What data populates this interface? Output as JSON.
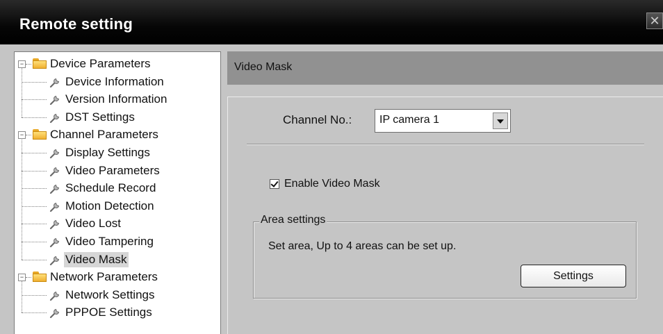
{
  "window": {
    "title": "Remote setting",
    "close_glyph": "✕"
  },
  "tree": {
    "groups": [
      {
        "label": "Device Parameters",
        "expanded": true,
        "children": [
          "Device Information",
          "Version Information",
          "DST Settings"
        ]
      },
      {
        "label": "Channel Parameters",
        "expanded": true,
        "children": [
          "Display Settings",
          "Video Parameters",
          "Schedule Record",
          "Motion Detection",
          "Video Lost",
          "Video Tampering",
          "Video Mask"
        ]
      },
      {
        "label": "Network Parameters",
        "expanded": true,
        "children": [
          "Network Settings",
          "PPPOE Settings"
        ]
      }
    ],
    "selected": "Video Mask",
    "expander_glyph": "−",
    "folder_icon": "folder-icon",
    "item_icon": "wrench-icon"
  },
  "panel": {
    "header": "Video Mask",
    "channel_label": "Channel No.:",
    "channel_value": "IP camera 1",
    "enable_label": "Enable Video Mask",
    "enable_checked": true,
    "area_group_title": "Area settings",
    "area_description": "Set area, Up to 4 areas can be set up.",
    "settings_button": "Settings"
  },
  "colors": {
    "titlebar": "#000000",
    "window_bg": "#c5c5c5",
    "header_bg": "#919191",
    "folder": "#f0b030"
  }
}
